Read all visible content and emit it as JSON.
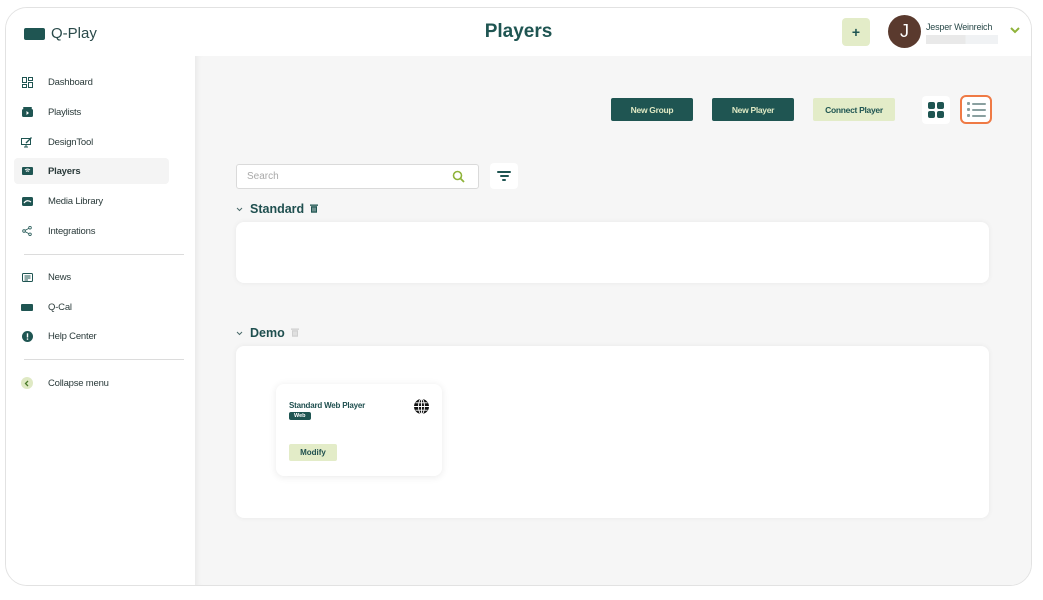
{
  "app": {
    "name": "Q-Play"
  },
  "header": {
    "title": "Players",
    "add_label": "+",
    "user": {
      "initial": "J",
      "name": "Jesper Weinreich",
      "chevron": "⌄"
    }
  },
  "sidebar": {
    "items": [
      {
        "label": "Dashboard",
        "icon": "dashboard-icon"
      },
      {
        "label": "Playlists",
        "icon": "playlist-icon"
      },
      {
        "label": "DesignTool",
        "icon": "design-tool-icon"
      },
      {
        "label": "Players",
        "icon": "player-icon",
        "active": true
      },
      {
        "label": "Media Library",
        "icon": "media-library-icon"
      },
      {
        "label": "Integrations",
        "icon": "share-icon"
      }
    ],
    "secondary": [
      {
        "label": "News",
        "icon": "news-icon"
      },
      {
        "label": "Q-Cal",
        "icon": "calendar-icon"
      },
      {
        "label": "Help Center",
        "icon": "help-icon"
      }
    ],
    "collapse": {
      "label": "Collapse menu",
      "icon": "chevron-left-icon"
    }
  },
  "toolbar": {
    "new_group": "New Group",
    "new_player": "New Player",
    "connect_player": "Connect Player",
    "view_mode": "list"
  },
  "search": {
    "placeholder": "Search",
    "value": ""
  },
  "groups": [
    {
      "name": "Standard",
      "players": []
    },
    {
      "name": "Demo",
      "players": [
        {
          "name": "Standard Web Player",
          "type": "Web",
          "action": "Modify"
        }
      ]
    }
  ],
  "colors": {
    "brand_dark": "#1f5552",
    "brand_light": "#e3ecc8",
    "accent_orange": "#ef7a45",
    "accent_green": "#8fb33a"
  }
}
